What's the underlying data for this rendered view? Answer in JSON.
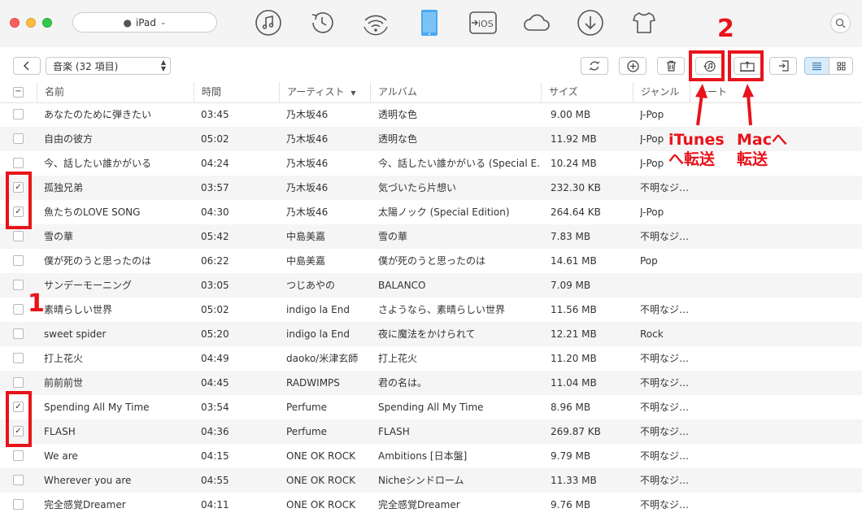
{
  "titlebar": {
    "device": "iPad",
    "nav_icons": [
      "music-note-icon",
      "history-clock-icon",
      "wifi-sync-icon",
      "ipad-device-icon",
      "to-ios-icon",
      "icloud-icon",
      "download-icon",
      "tshirt-icon"
    ],
    "to_ios_text": "iOS"
  },
  "toolbar": {
    "category": "音楽 (32 項目)"
  },
  "annotations": {
    "step1": "1",
    "step2": "2",
    "itunes_line1": "iTunes",
    "itunes_line2": "へ転送",
    "mac_line1": "Macへ",
    "mac_line2": "転送",
    "color": "#e8131b"
  },
  "table": {
    "headers": {
      "name": "名前",
      "time": "時間",
      "artist": "アーティスト",
      "album": "アルバム",
      "size": "サイズ",
      "genre": "ジャンル",
      "rate": "レート"
    },
    "header_checkbox": "−",
    "rows": [
      {
        "name": "あなたのために弾きたい",
        "time": "03:45",
        "artist": "乃木坂46",
        "album": "透明な色",
        "size": "9.00 MB",
        "genre": "J-Pop",
        "checked": false
      },
      {
        "name": "自由の彼方",
        "time": "05:02",
        "artist": "乃木坂46",
        "album": "透明な色",
        "size": "11.92 MB",
        "genre": "J-Pop",
        "checked": false
      },
      {
        "name": "今、話したい誰かがいる",
        "time": "04:24",
        "artist": "乃木坂46",
        "album": "今、話したい誰かがいる (Special E…",
        "size": "10.24 MB",
        "genre": "J-Pop",
        "checked": false
      },
      {
        "name": "孤独兄弟",
        "time": "03:57",
        "artist": "乃木坂46",
        "album": "気づいたら片想い",
        "size": "232.30 KB",
        "genre": "不明なジ…",
        "checked": true
      },
      {
        "name": "魚たちのLOVE SONG",
        "time": "04:30",
        "artist": "乃木坂46",
        "album": "太陽ノック (Special Edition)",
        "size": "264.64 KB",
        "genre": "J-Pop",
        "checked": true
      },
      {
        "name": "雪の華",
        "time": "05:42",
        "artist": "中島美嘉",
        "album": "雪の華",
        "size": "7.83 MB",
        "genre": "不明なジ…",
        "checked": false
      },
      {
        "name": "僕が死のうと思ったのは",
        "time": "06:22",
        "artist": "中島美嘉",
        "album": "僕が死のうと思ったのは",
        "size": "14.61 MB",
        "genre": "Pop",
        "checked": false
      },
      {
        "name": "サンデーモーニング",
        "time": "03:05",
        "artist": "つじあやの",
        "album": "BALANCO",
        "size": "7.09 MB",
        "genre": "",
        "checked": false
      },
      {
        "name": "素晴らしい世界",
        "time": "05:02",
        "artist": "indigo la End",
        "album": "さようなら、素晴らしい世界",
        "size": "11.56 MB",
        "genre": "不明なジ…",
        "checked": false
      },
      {
        "name": "sweet spider",
        "time": "05:20",
        "artist": "indigo la End",
        "album": "夜に魔法をかけられて",
        "size": "12.21 MB",
        "genre": "Rock",
        "checked": false
      },
      {
        "name": "打上花火",
        "time": "04:49",
        "artist": "daoko/米津玄師",
        "album": "打上花火",
        "size": "11.20 MB",
        "genre": "不明なジ…",
        "checked": false
      },
      {
        "name": "前前前世",
        "time": "04:45",
        "artist": "RADWIMPS",
        "album": "君の名は。",
        "size": "11.04 MB",
        "genre": "不明なジ…",
        "checked": false
      },
      {
        "name": "Spending All My Time",
        "time": "03:54",
        "artist": "Perfume",
        "album": "Spending All My Time",
        "size": "8.96 MB",
        "genre": "不明なジ…",
        "checked": true
      },
      {
        "name": "FLASH",
        "time": "04:36",
        "artist": "Perfume",
        "album": "FLASH",
        "size": "269.87 KB",
        "genre": "不明なジ…",
        "checked": true
      },
      {
        "name": "We are",
        "time": "04:15",
        "artist": "ONE OK ROCK",
        "album": "Ambitions [日本盤]",
        "size": "9.79 MB",
        "genre": "不明なジ…",
        "checked": false
      },
      {
        "name": "Wherever you are",
        "time": "04:55",
        "artist": "ONE OK ROCK",
        "album": "Nicheシンドローム",
        "size": "11.33 MB",
        "genre": "不明なジ…",
        "checked": false
      },
      {
        "name": "完全感覚Dreamer",
        "time": "04:11",
        "artist": "ONE OK ROCK",
        "album": "完全感覚Dreamer",
        "size": "9.76 MB",
        "genre": "不明なジ…",
        "checked": false
      }
    ]
  }
}
